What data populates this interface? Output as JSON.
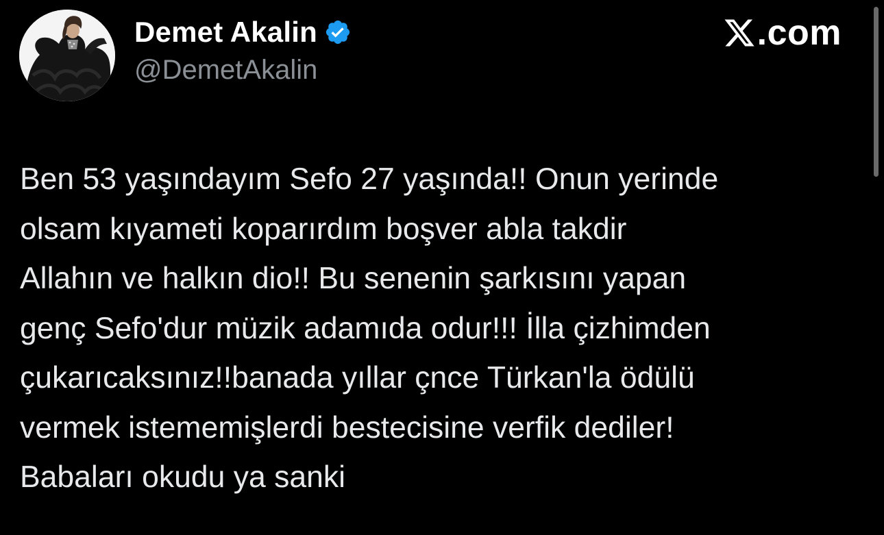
{
  "header": {
    "display_name": "Demet Akalin",
    "handle": "@DemetAkalin",
    "verified_badge_icon": "verified-check-icon",
    "verified_badge_color": "#1d9bf0",
    "avatar_icon": "profile-avatar-image",
    "site_logo_icon": "x-logo-icon",
    "site_logo_text": ".com"
  },
  "tweet": {
    "lines": [
      "Ben 53 yaşındayım Sefo 27 yaşında!! Onun yerinde",
      "olsam kıyameti koparırdım boşver abla takdir",
      "Allahın ve halkın dio!! Bu senenin şarkısını yapan",
      "genç Sefo'dur müzik adamıda odur!!! İlla çizhimden",
      "çukarıcaksınız!!banada yıllar çnce Türkan'la ödülü",
      "vermek istememişlerdi bestecisine verfik dediler!",
      "Babaları okudu ya sanki"
    ]
  },
  "theme": {
    "background": "#000000",
    "text_primary": "#e7e9ea",
    "text_secondary": "#8b9096"
  }
}
